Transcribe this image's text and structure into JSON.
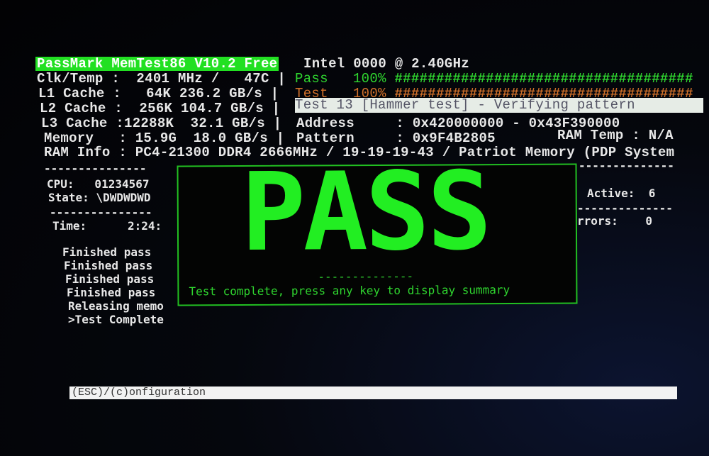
{
  "header": {
    "title": "PassMark MemTest86 V10.2 Free",
    "cpu": "Intel 0000 @ 2.40GHz"
  },
  "system": [
    {
      "label": "Clk/Temp",
      "value": "  2401 MHz /   47C"
    },
    {
      "label": "L1 Cache",
      "value": "   64K 236.2 GB/s"
    },
    {
      "label": "L2 Cache",
      "value": "  256K 104.7 GB/s"
    },
    {
      "label": "L3 Cache",
      "value": "12288K  32.1 GB/s"
    },
    {
      "label": "Memory  ",
      "value": " 15.9G  18.0 GB/s"
    }
  ],
  "ram_info": "RAM Info : PC4-21300 DDR4 2666MHz / 19-19-19-43 / Patriot Memory (PDP System",
  "progress": {
    "pass": {
      "label": "Pass",
      "percent": "100%",
      "bar": "####################################",
      "value": 100,
      "color": "#2fd52f"
    },
    "test": {
      "label": "Test",
      "percent": "100%",
      "bar": "####################################",
      "value": 100,
      "color": "#d0702a"
    }
  },
  "current_test": "Test 13 [Hammer test] - Verifying pattern",
  "address": {
    "label": "Address",
    "value": "0x420000000 - 0x43F390000"
  },
  "pattern": {
    "label": "Pattern",
    "value": "0x9F4B2805"
  },
  "ram_temp": "RAM Temp : N/A",
  "left_panel": {
    "divider": "---------------",
    "cpu": "CPU:   01234567",
    "state": "State: \\DWDWDWD",
    "time": "Time:      2:24:"
  },
  "log": [
    "Finished pass",
    "Finished pass",
    "Finished pass",
    "Finished pass",
    "Releasing memo",
    ">Test Complete"
  ],
  "right_panel": {
    "divider": "--------------",
    "active": "Active:  6",
    "errors": "rrors:    0"
  },
  "popup": {
    "result": "PASS",
    "divider": "--------------",
    "message": "Test complete, press any key to display summary"
  },
  "footer": {
    "hint": "(ESC)/(c)onfiguration"
  },
  "colors": {
    "accent": "#22e022",
    "background": "#020204"
  }
}
